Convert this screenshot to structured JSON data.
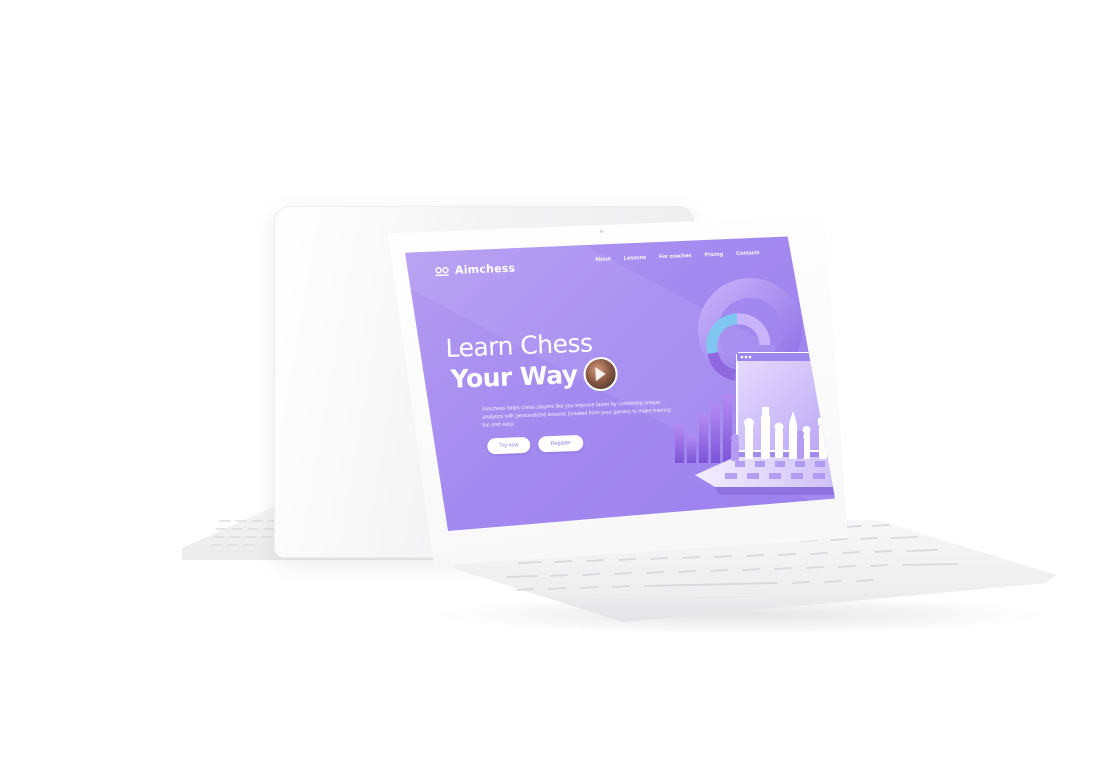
{
  "site": {
    "brand": "Aimchess"
  },
  "nav": {
    "items": [
      "About",
      "Lessons",
      "For coaches",
      "Pricing",
      "Contacts"
    ]
  },
  "hero": {
    "line1": "Learn Chess",
    "line2": "Your Way",
    "description": "Aimchess helps chess players like you improve faster by combining unique analytics with personalized lessons (created from your games) to make training fun and easy.",
    "primary_button": "Try now",
    "secondary_button": "Register"
  },
  "colors": {
    "accent": "#a68cf0",
    "accent_dark": "#8f78e6",
    "text_on_accent": "#ffffff"
  },
  "icons": {
    "logo": "chess-glasses-icon",
    "avatar_overlay": "play-icon"
  }
}
